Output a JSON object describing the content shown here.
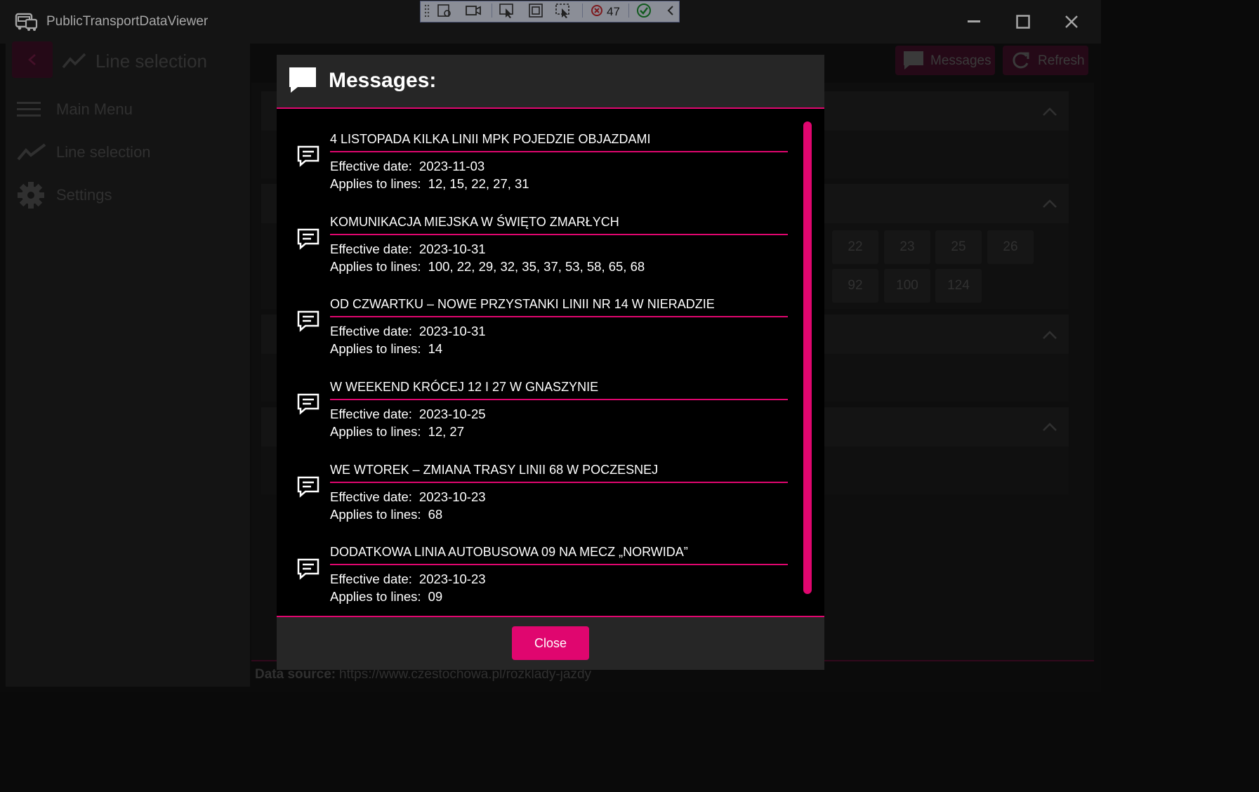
{
  "app": {
    "title": "PublicTransportDataViewer"
  },
  "debug_toolbar": {
    "error_count": "47"
  },
  "header": {
    "page_title": "Line selection",
    "messages_label": "Messages",
    "refresh_label": "Refresh"
  },
  "sidebar": {
    "items": [
      {
        "label": "Main Menu",
        "icon": "hamburger-icon"
      },
      {
        "label": "Line selection",
        "icon": "line-chart-icon"
      },
      {
        "label": "Settings",
        "icon": "gear-icon"
      }
    ]
  },
  "background_lines": {
    "row1": [
      "22",
      "23",
      "25",
      "26"
    ],
    "row2": [
      "92",
      "100",
      "124"
    ]
  },
  "footer": {
    "data_source_label": "Data source:",
    "data_source_value": "https://www.czestochowa.pl/rozklady-jazdy"
  },
  "dialog": {
    "title": "Messages:",
    "effective_label": "Effective date:",
    "applies_label": "Applies to lines:",
    "close_label": "Close",
    "messages": [
      {
        "title": "4 LISTOPADA KILKA LINII MPK POJEDZIE OBJAZDAMI",
        "date": "2023-11-03",
        "lines": "12, 15, 22, 27, 31"
      },
      {
        "title": "KOMUNIKACJA MIEJSKA W ŚWIĘTO ZMARŁYCH",
        "date": "2023-10-31",
        "lines": "100, 22, 29, 32, 35, 37, 53, 58, 65, 68"
      },
      {
        "title": "OD CZWARTKU – NOWE PRZYSTANKI LINII NR 14 W NIERADZIE",
        "date": "2023-10-31",
        "lines": "14"
      },
      {
        "title": "W WEEKEND KRÓCEJ 12 I 27 W GNASZYNIE",
        "date": "2023-10-25",
        "lines": "12, 27"
      },
      {
        "title": "WE WTOREK – ZMIANA TRASY LINII 68 W POCZESNEJ",
        "date": "2023-10-23",
        "lines": "68"
      },
      {
        "title": "DODATKOWA LINIA AUTOBUSOWA 09 NA MECZ „NORWIDA”",
        "date": "2023-10-23",
        "lines": "09"
      }
    ]
  },
  "colors": {
    "accent": "#e0066f",
    "dialog_bg": "#000000",
    "panel": "#262626"
  }
}
